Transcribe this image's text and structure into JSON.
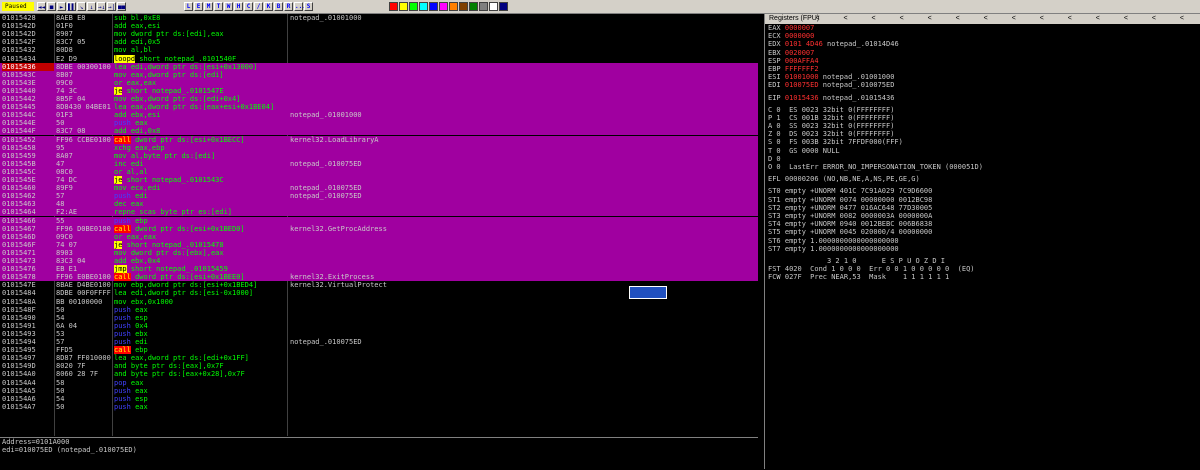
{
  "toolbar": {
    "status": "Paused",
    "controls": [
      "◄◄",
      "■",
      "►",
      "▌▌",
      "↘",
      "↓",
      "→↓",
      "→|",
      "■■"
    ],
    "letters": [
      "L",
      "E",
      "M",
      "T",
      "W",
      "H",
      "C",
      "/",
      "K",
      "B",
      "R",
      "...",
      "S"
    ],
    "colors": [
      "#ff0000",
      "#ffff00",
      "#00ff00",
      "#00ffff",
      "#0000ff",
      "#ff00ff",
      "#ff8000",
      "#804000",
      "#008000",
      "#808080",
      "#ffffff",
      "#000080"
    ]
  },
  "disasm": [
    {
      "addr": "01015428",
      "hex": "8AEB E8",
      "ins": "sub bl,0xE8",
      "cmt": "notepad_.01001000",
      "hl": false
    },
    {
      "addr": "0101542D",
      "hex": "01F0",
      "ins": "add eax,esi",
      "cmt": "",
      "hl": false
    },
    {
      "addr": "0101542D",
      "hex": "8907",
      "ins": "mov dword ptr ds:[edi],eax",
      "cmt": "",
      "hl": false
    },
    {
      "addr": "0101542F",
      "hex": "83C7 05",
      "ins": "add edi,0x5",
      "cmt": "",
      "hl": false
    },
    {
      "addr": "01015432",
      "hex": "80D8",
      "ins": "mov al,bl",
      "cmt": "",
      "hl": false
    },
    {
      "addr": "01015434",
      "hex": "E2 D9",
      "ins": "loopd short notepad_.0101540F",
      "cmt": "",
      "hl": false
    },
    {
      "addr": "01015436",
      "hex": "8DBE 00300100",
      "ins": "lea edi,dword ptr ds:[esi+0x13000]",
      "cmt": "",
      "hl": true,
      "sel": true
    },
    {
      "addr": "0101543C",
      "hex": "8B07",
      "ins": "mov eax,dword ptr ds:[edi]",
      "cmt": "",
      "hl": true
    },
    {
      "addr": "0101543E",
      "hex": "09C0",
      "ins": "or eax,eax",
      "cmt": "",
      "hl": true
    },
    {
      "addr": "01015440",
      "hex": "74 3C",
      "ins": "je short notepad_.0101547E",
      "cmt": "",
      "hl": true
    },
    {
      "addr": "01015442",
      "hex": "8B5F 04",
      "ins": "mov ebx,dword ptr ds:[edi+0x4]",
      "cmt": "",
      "hl": true
    },
    {
      "addr": "01015445",
      "hex": "8D8430 04BE01",
      "ins": "lea eax,dword ptr ds:[eax+esi+0x1BE04]",
      "cmt": "",
      "hl": true
    },
    {
      "addr": "0101544C",
      "hex": "01F3",
      "ins": "add ebx,esi",
      "cmt": "notepad_.01001000",
      "hl": true
    },
    {
      "addr": "0101544E",
      "hex": "50",
      "ins": "push eax",
      "cmt": "",
      "hl": true
    },
    {
      "addr": "0101544F",
      "hex": "83C7 08",
      "ins": "add edi,0x8",
      "cmt": "",
      "hl": true
    },
    {
      "addr": "01015452",
      "hex": "FF96 CCBE0100",
      "ins": "call dword ptr ds:[esi+0x1BECC]",
      "cmt": "kernel32.LoadLibraryA",
      "hl": true
    },
    {
      "addr": "01015458",
      "hex": "95",
      "ins": "xchg eax,ebp",
      "cmt": "",
      "hl": true
    },
    {
      "addr": "01015459",
      "hex": "8A07",
      "ins": "mov al,byte ptr ds:[edi]",
      "cmt": "",
      "hl": true
    },
    {
      "addr": "0101545B",
      "hex": "47",
      "ins": "inc edi",
      "cmt": "notepad_.010075ED",
      "hl": true
    },
    {
      "addr": "0101545C",
      "hex": "08C0",
      "ins": "or al,al",
      "cmt": "",
      "hl": true
    },
    {
      "addr": "0101545E",
      "hex": "74 DC",
      "ins": "je short notepad_.0101543C",
      "cmt": "",
      "hl": true
    },
    {
      "addr": "01015460",
      "hex": "89F9",
      "ins": "mov ecx,edi",
      "cmt": "notepad_.010075ED",
      "hl": true
    },
    {
      "addr": "01015462",
      "hex": "57",
      "ins": "push edi",
      "cmt": "notepad_.010075ED",
      "hl": true
    },
    {
      "addr": "01015463",
      "hex": "48",
      "ins": "dec eax",
      "cmt": "",
      "hl": true
    },
    {
      "addr": "01015464",
      "hex": "F2:AE",
      "ins": "repne scas byte ptr es:[edi]",
      "cmt": "",
      "hl": true
    },
    {
      "addr": "01015466",
      "hex": "55",
      "ins": "push ebp",
      "cmt": "",
      "hl": true
    },
    {
      "addr": "01015467",
      "hex": "FF96 D0BE0100",
      "ins": "call dword ptr ds:[esi+0x1BED0]",
      "cmt": "kernel32.GetProcAddress",
      "hl": true
    },
    {
      "addr": "0101546D",
      "hex": "09C0",
      "ins": "or eax,eax",
      "cmt": "",
      "hl": true
    },
    {
      "addr": "0101546F",
      "hex": "74 07",
      "ins": "je short notepad_.01015478",
      "cmt": "",
      "hl": true
    },
    {
      "addr": "01015471",
      "hex": "8903",
      "ins": "mov dword ptr ds:[ebx],eax",
      "cmt": "",
      "hl": true
    },
    {
      "addr": "01015473",
      "hex": "83C3 04",
      "ins": "add ebx,0x4",
      "cmt": "",
      "hl": true
    },
    {
      "addr": "01015476",
      "hex": "EB E1",
      "ins": "jmp short notepad_.01015459",
      "cmt": "",
      "hl": true
    },
    {
      "addr": "01015478",
      "hex": "FF96 E0BE0100",
      "ins": "call dword ptr ds:[esi+0x1BEE0]",
      "cmt": "kernel32.ExitProcess",
      "hl": true
    },
    {
      "addr": "0101547E",
      "hex": "8BAE D4BE0100",
      "ins": "mov ebp,dword ptr ds:[esi+0x1BED4]",
      "cmt": "kernel32.VirtualProtect",
      "hl": false
    },
    {
      "addr": "01015484",
      "hex": "8DBE 00F0FFFF",
      "ins": "lea edi,dword ptr ds:[esi-0x1000]",
      "cmt": "",
      "hl": false
    },
    {
      "addr": "0101548A",
      "hex": "BB 00100000",
      "ins": "mov ebx,0x1000",
      "cmt": "",
      "hl": false
    },
    {
      "addr": "0101548F",
      "hex": "50",
      "ins": "push eax",
      "cmt": "",
      "hl": false
    },
    {
      "addr": "01015490",
      "hex": "54",
      "ins": "push esp",
      "cmt": "",
      "hl": false
    },
    {
      "addr": "01015491",
      "hex": "6A 04",
      "ins": "push 0x4",
      "cmt": "",
      "hl": false
    },
    {
      "addr": "01015493",
      "hex": "53",
      "ins": "push ebx",
      "cmt": "",
      "hl": false
    },
    {
      "addr": "01015494",
      "hex": "57",
      "ins": "push edi",
      "cmt": "notepad_.010075ED",
      "hl": false
    },
    {
      "addr": "01015495",
      "hex": "FFD5",
      "ins": "call ebp",
      "cmt": "",
      "hl": false
    },
    {
      "addr": "01015497",
      "hex": "8D87 FF010000",
      "ins": "lea eax,dword ptr ds:[edi+0x1FF]",
      "cmt": "",
      "hl": false
    },
    {
      "addr": "0101549D",
      "hex": "8020 7F",
      "ins": "and byte ptr ds:[eax],0x7F",
      "cmt": "",
      "hl": false
    },
    {
      "addr": "010154A0",
      "hex": "8060 28 7F",
      "ins": "and byte ptr ds:[eax+0x28],0x7F",
      "cmt": "",
      "hl": false
    },
    {
      "addr": "010154A4",
      "hex": "58",
      "ins": "pop eax",
      "cmt": "",
      "hl": false
    },
    {
      "addr": "010154A5",
      "hex": "50",
      "ins": "push eax",
      "cmt": "",
      "hl": false
    },
    {
      "addr": "010154A6",
      "hex": "54",
      "ins": "push esp",
      "cmt": "",
      "hl": false
    },
    {
      "addr": "010154A7",
      "hex": "50",
      "ins": "push eax",
      "cmt": "",
      "hl": false
    }
  ],
  "info": {
    "line1": "Address=0101A000",
    "line2": "edi=010075ED (notepad_.010075ED)"
  },
  "registers": {
    "title": "Registers (FPU)",
    "arrows": "< < < < < < < < < < < < < <",
    "gpr": [
      {
        "n": "EAX",
        "v": "0000007",
        "c": ""
      },
      {
        "n": "ECX",
        "v": "0000000",
        "c": ""
      },
      {
        "n": "EDX",
        "v": "0101 4D46",
        "c": "notepad_.01014D46"
      },
      {
        "n": "EBX",
        "v": "0020007",
        "c": ""
      },
      {
        "n": "ESP",
        "v": "000AFFA4",
        "c": ""
      },
      {
        "n": "EBP",
        "v": "FFFFFFF2",
        "c": ""
      },
      {
        "n": "ESI",
        "v": "01001000",
        "c": "notepad_.01001000"
      },
      {
        "n": "EDI",
        "v": "010075ED",
        "c": "notepad_.010075ED"
      }
    ],
    "eip": {
      "n": "EIP",
      "v": "01015436",
      "c": "notepad_.01015436"
    },
    "flags": [
      "C 0  ES 0023 32bit 0(FFFFFFFF)",
      "P 1  CS 001B 32bit 0(FFFFFFFF)",
      "A 0  SS 0023 32bit 0(FFFFFFFF)",
      "Z 0  DS 0023 32bit 0(FFFFFFFF)",
      "S 0  FS 003B 32bit 7FFDF000(FFF)",
      "T 0  GS 0000 NULL",
      "D 0",
      "O 0  LastErr ERROR_NO_IMPERSONATION_TOKEN (000051D)"
    ],
    "efl": "EFL 00000206 (NO,NB,NE,A,NS,PE,GE,G)",
    "fpu": [
      "ST0 empty +UNORM 401C 7C91A029 7C9D6600",
      "ST1 empty +UNORM 0074 00000000 0012BC98",
      "ST2 empty +UNORM 0477 016AC648 77D30005",
      "ST3 empty +UNORM 0082 0000003A 0000000A",
      "ST4 empty +UNORM 0940 0012BEBC 006B6838",
      "ST5 empty +UNORM 0045 020000/4 00000000",
      "ST6 empty 1.0000000000000000000",
      "ST7 empty 1.0000000000000000000"
    ],
    "fpu_tail": [
      "              3 2 1 0      E S P U O Z D I",
      "FST 4020  Cond 1 0 0 0  Err 0 0 1 0 0 0 0 0  (EQ)",
      "FCW 027F  Prec NEAR,53  Mask    1 1 1 1 1 1"
    ]
  }
}
